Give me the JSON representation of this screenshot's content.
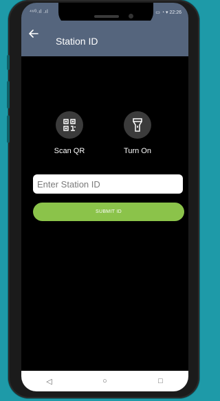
{
  "statusbar": {
    "left": "⁴⁶ᴳ.ıl .ıl",
    "right": "▭ ◔ ▾ 22:26"
  },
  "appbar": {
    "back_icon": "back-arrow-icon",
    "title": "Station ID"
  },
  "actions": [
    {
      "label": "Scan QR",
      "icon": "qr-code-icon"
    },
    {
      "label": "Turn On",
      "icon": "flashlight-icon"
    }
  ],
  "form": {
    "placeholder": "Enter Station ID",
    "submit_label": "SUBMIT ID"
  },
  "navbar": {
    "back": "◁",
    "home": "○",
    "recents": "□"
  },
  "colors": {
    "appbar": "#55657d",
    "submit": "#8bc34a",
    "background": "#000000"
  }
}
